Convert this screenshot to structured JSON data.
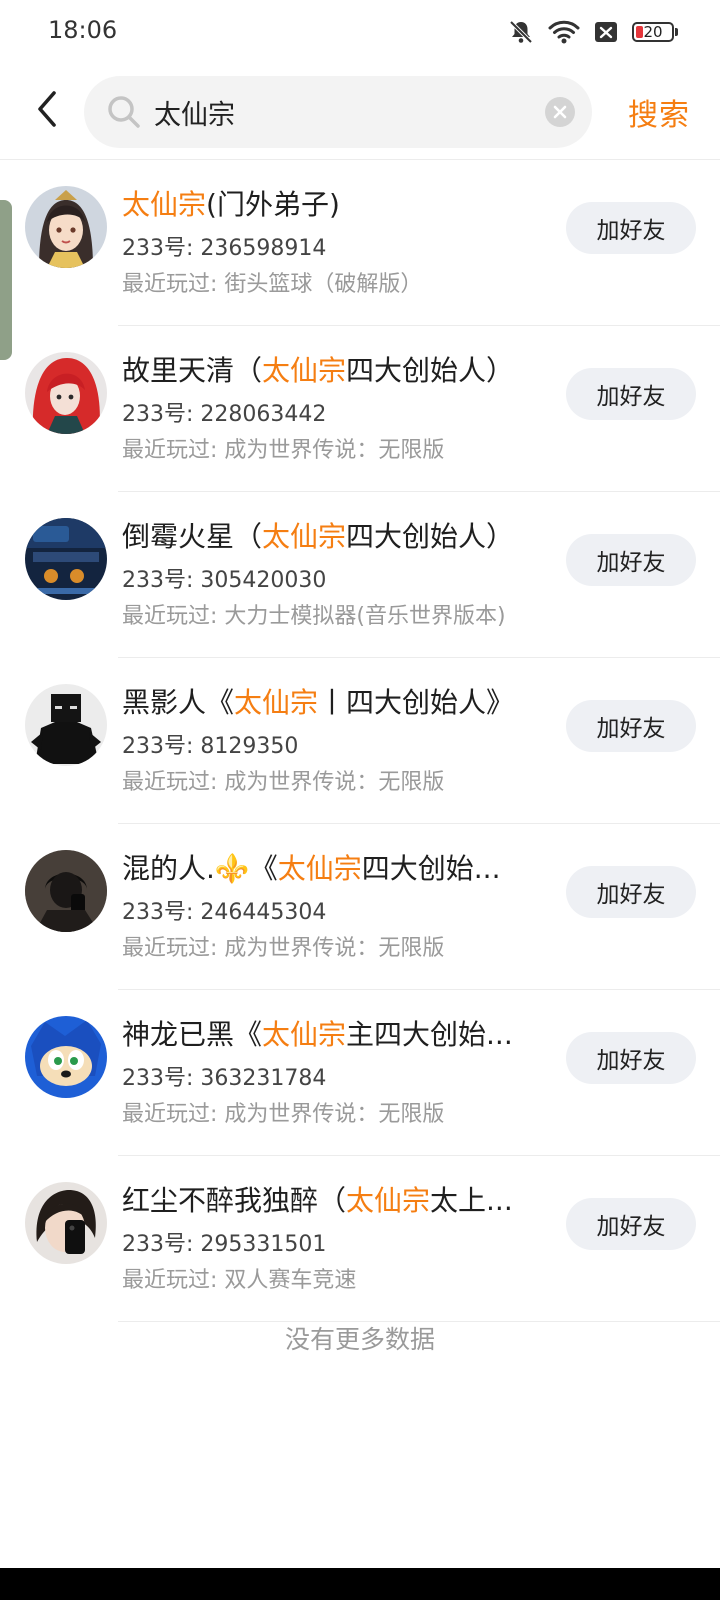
{
  "status_bar": {
    "time": "18:06",
    "battery_text": "20",
    "battery_level_percent": 20,
    "icons": [
      "bell-muted-icon",
      "wifi-icon",
      "notification-x-icon",
      "battery-icon"
    ]
  },
  "header": {
    "search_value": "太仙宗",
    "search_button": "搜索"
  },
  "colors": {
    "accent": "#f57e12",
    "button_bg": "#eef0f4",
    "muted_text": "#9a9a9a"
  },
  "results": [
    {
      "name_pre": "",
      "name_hl": "太仙宗",
      "name_post": "(门外弟子)",
      "uid": "233号: 236598914",
      "recent": "最近玩过: 街头篮球（破解版）",
      "button": "加好友"
    },
    {
      "name_pre": "故里天清（",
      "name_hl": "太仙宗",
      "name_post": "四大创始人）",
      "uid": "233号: 228063442",
      "recent": "最近玩过: 成为世界传说：无限版",
      "button": "加好友"
    },
    {
      "name_pre": "倒霉火星（",
      "name_hl": "太仙宗",
      "name_post": "四大创始人）",
      "uid": "233号: 305420030",
      "recent": "最近玩过: 大力士模拟器(音乐世界版本)",
      "button": "加好友"
    },
    {
      "name_pre": "黑影人《",
      "name_hl": "太仙宗",
      "name_post": "丨四大创始人》",
      "uid": "233号: 8129350",
      "recent": "最近玩过: 成为世界传说：无限版",
      "button": "加好友"
    },
    {
      "name_pre": "混的人.⚜️《",
      "name_hl": "太仙宗",
      "name_post": "四大创始...",
      "uid": "233号: 246445304",
      "recent": "最近玩过: 成为世界传说：无限版",
      "button": "加好友"
    },
    {
      "name_pre": "神龙已黑《",
      "name_hl": "太仙宗",
      "name_post": "主四大创始...",
      "uid": "233号: 363231784",
      "recent": "最近玩过: 成为世界传说：无限版",
      "button": "加好友"
    },
    {
      "name_pre": "红尘不醉我独醉（",
      "name_hl": "太仙宗",
      "name_post": "太上...",
      "uid": "233号: 295331501",
      "recent": "最近玩过: 双人赛车竞速",
      "button": "加好友"
    }
  ],
  "footer": {
    "no_more": "没有更多数据"
  }
}
